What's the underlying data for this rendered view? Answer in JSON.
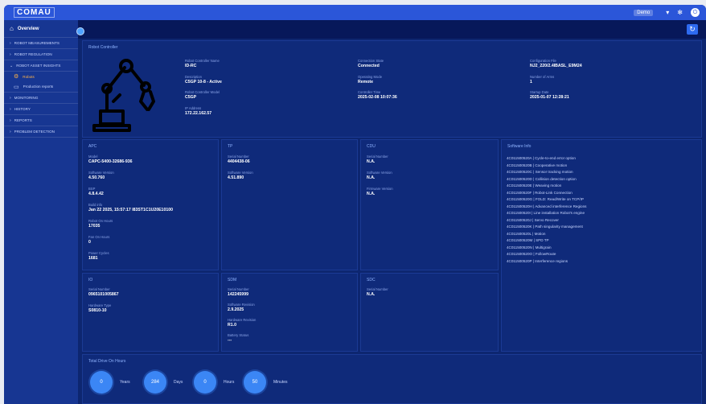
{
  "app": {
    "logo": "COMAU"
  },
  "topbar": {
    "user": "Demo"
  },
  "sidebar": {
    "home": "Overview",
    "items": [
      {
        "label": "ROBOT MEASUREMENTS"
      },
      {
        "label": "ROBOT REGULATION"
      },
      {
        "label": "ROBOT ASSET INSIGHTS"
      }
    ],
    "subitems": [
      {
        "label": "Robots",
        "active": true
      },
      {
        "label": "Production reports"
      }
    ],
    "items2": [
      {
        "label": "MONITORING"
      },
      {
        "label": "HISTORY"
      },
      {
        "label": "REPORTS"
      },
      {
        "label": "PROBLEM DETECTION"
      }
    ]
  },
  "controller": {
    "title": "Robot Controller",
    "fields": [
      {
        "label": "Robot Controller Name",
        "value": "ID-RC"
      },
      {
        "label": "Description",
        "value": "C5GP 10-8 - Active"
      },
      {
        "label": "Robot Controller Model",
        "value": "C5GP"
      },
      {
        "label": "IP Address",
        "value": "172.22.162.57"
      },
      {
        "label": "Connection State",
        "value": "Connected"
      },
      {
        "label": "Operating Mode",
        "value": "Remote"
      },
      {
        "label": "Controller Time",
        "value": "2025-02-08 10:07:36"
      },
      {
        "label": "Configuration File",
        "value": "NJ2_220/2.4IBASL_E9M24"
      },
      {
        "label": "Number of Arms",
        "value": "1"
      },
      {
        "label": "Startup Date",
        "value": "2025-01-07 12:28:21"
      }
    ]
  },
  "apc": {
    "title": "APC",
    "fields": [
      {
        "label": "Model",
        "value": "CAPC-5400-32686-936"
      },
      {
        "label": "Software Version",
        "value": "4.50.760"
      },
      {
        "label": "BSP",
        "value": "4.8.4.42"
      },
      {
        "label": "Build info",
        "value": "Jan 22 2025, 15:57:17 I83ST1C1U20E10100"
      },
      {
        "label": "Robot On Hours",
        "value": "17035"
      },
      {
        "label": "Fan On Hours",
        "value": "0"
      },
      {
        "label": "Power Cycles",
        "value": "1681"
      }
    ]
  },
  "tp": {
    "title": "TP",
    "fields": [
      {
        "label": "Serial Number",
        "value": "4404438-06"
      },
      {
        "label": "Software Version",
        "value": "4.51.890"
      }
    ]
  },
  "cdu": {
    "title": "CDU",
    "fields": [
      {
        "label": "Serial Number",
        "value": "N.A."
      },
      {
        "label": "Software Version",
        "value": "N.A."
      },
      {
        "label": "Firmware Version",
        "value": "N.A."
      }
    ]
  },
  "software": {
    "title": "Software Info",
    "items": [
      "4C011500520A | Cycle-to-end error option",
      "4C011500520B | Cooperative motion",
      "4C011500520C | Sensor tracking motion",
      "4C011500520D | Collision detection option",
      "4C011500520E | Weaving motion",
      "4C011500520F | Robot-Link Connection",
      "4C011500520G | FOLD: Read/Write on TCP/IP",
      "4C011500520H | Advanced interference Regions",
      "4C011500520I | Line installation Robot's engine",
      "4C011500520J | Servo Recover",
      "4C011500520K | Path singularity management",
      "4C011500520L | Motion",
      "4C011500520M | SPD TP",
      "4C011500520N | Multigrain",
      "4C011500520O | FollowRoute",
      "4C011500520P | Interference regions"
    ]
  },
  "io": {
    "title": "IO",
    "fields": [
      {
        "label": "Serial Number",
        "value": "0965101005867"
      },
      {
        "label": "Hardware Type",
        "value": "S0810-10"
      }
    ]
  },
  "sdm": {
    "title": "SDM",
    "fields": [
      {
        "label": "Serial Number",
        "value": "142245999"
      },
      {
        "label": "Software Revision",
        "value": "2.9.2025"
      },
      {
        "label": "Hardware Revision",
        "value": "R1.0"
      },
      {
        "label": "Battery Status",
        "value": "---"
      }
    ]
  },
  "sdc": {
    "title": "SDC",
    "fields": [
      {
        "label": "Serial Number",
        "value": "N.A."
      }
    ]
  },
  "uptime": {
    "title": "Total Drive On Hours",
    "counters": [
      {
        "value": "0",
        "unit": "Years"
      },
      {
        "value": "284",
        "unit": "Days"
      },
      {
        "value": "0",
        "unit": "Hours"
      },
      {
        "value": "50",
        "unit": "Minutes"
      }
    ]
  },
  "colors": {
    "background": "#0d2670",
    "topbar": "#2b56d9",
    "sidebar": "#173692",
    "accent": "#3b86f5",
    "active": "#ffb347"
  }
}
